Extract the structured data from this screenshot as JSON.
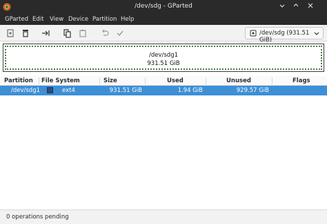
{
  "window": {
    "title": "/dev/sdg - GParted"
  },
  "menubar": {
    "items": [
      "GParted",
      "Edit",
      "View",
      "Device",
      "Partition",
      "Help"
    ]
  },
  "toolbar": {
    "icons": [
      "new-partition-icon",
      "delete-partition-icon",
      "resize-move-icon",
      "copy-icon",
      "paste-icon",
      "undo-icon",
      "apply-icon"
    ],
    "device_label": "/dev/sdg (931.51 GiB)"
  },
  "disk_map": {
    "partition_name": "/dev/sdg1",
    "partition_size": "931.51 GiB",
    "border_color": "#4a7a4a"
  },
  "table": {
    "headers": [
      "Partition",
      "File System",
      "Size",
      "Used",
      "Unused",
      "Flags"
    ],
    "rows": [
      {
        "partition": "/dev/sdg1",
        "filesystem": "ext4",
        "size": "931.51 GiB",
        "used": "1.94 GiB",
        "unused": "929.57 GiB",
        "flags": "",
        "fs_color": "#2f4d7a"
      }
    ]
  },
  "statusbar": {
    "text": "0 operations pending"
  },
  "colors": {
    "selection": "#3d8fd6",
    "titlebar": "#2a2a2a"
  }
}
